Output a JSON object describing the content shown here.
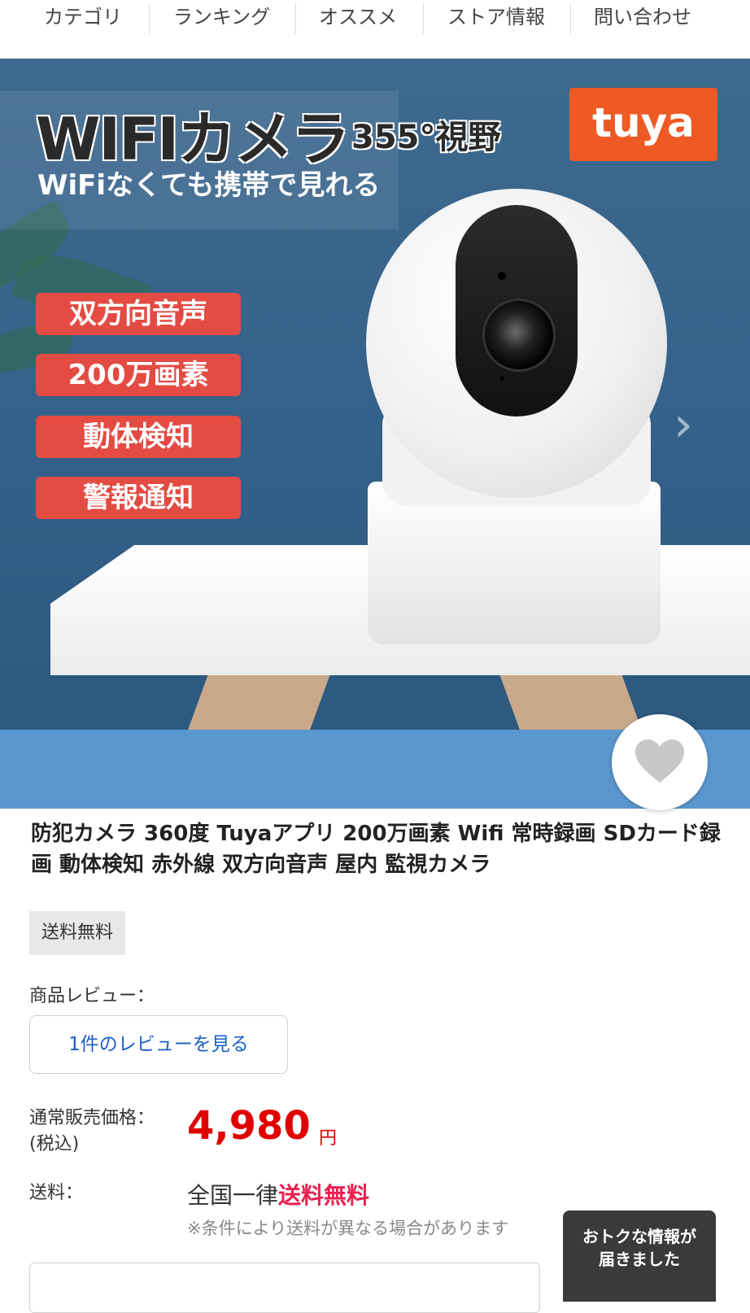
{
  "nav": {
    "items": [
      {
        "label": "カテゴリ"
      },
      {
        "label": "ランキング"
      },
      {
        "label": "オススメ"
      },
      {
        "label": "ストア情報"
      },
      {
        "label": "問い合わせ"
      }
    ]
  },
  "hero": {
    "headline": "WIFIカメラ",
    "headline_sub": "355°視野",
    "tagline": "WiFiなくても携帯で見れる",
    "brand_logo": "tuya",
    "features": [
      "双方向音声",
      "200万画素",
      "動体検知",
      "警報通知"
    ],
    "next_icon": "chevron-right-icon",
    "next_glyph": "›"
  },
  "favorite": {
    "icon": "heart-icon",
    "color": "#c8c8c8"
  },
  "product": {
    "title": "防犯カメラ 360度 Tuyaアプリ 200万画素 Wifi 常時録画 SDカード録画 動体検知 赤外線 双方向音声 屋内 監視カメラ",
    "badge": "送料無料",
    "review_label": "商品レビュー：",
    "review_button": "1件のレビューを見る",
    "price_label": "通常販売価格：",
    "price_tax_note": "(税込)",
    "price": "4,980",
    "currency": "円",
    "shipping_label": "送料：",
    "shipping_prefix": "全国一律",
    "shipping_free": "送料無料",
    "shipping_note": "※条件により送料が異なる場合があります"
  },
  "popup": {
    "line1": "おトクな情報が",
    "line2": "届きました"
  },
  "colors": {
    "price": "#e00000",
    "link": "#1a5fc6",
    "free_shipping": "#e8204f",
    "feature_badge": "#e34b43",
    "brand": "#ee5a24"
  }
}
